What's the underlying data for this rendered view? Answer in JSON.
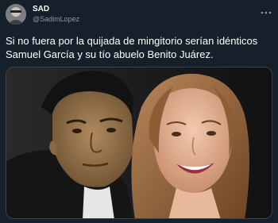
{
  "author": {
    "display_name": "SAD",
    "handle": "@SadimLopez",
    "avatar_icon": "avatar-photo-icon"
  },
  "menu": {
    "icon": "more-dots-icon"
  },
  "tweet": {
    "text": "Si no fuera por la quijada de mingitorio serían idénticos Samuel García y su tío abuelo Benito Juárez."
  },
  "media": {
    "kind": "photo",
    "icon": "photo-icon"
  },
  "colors": {
    "background": "#15202b",
    "text_primary": "#ffffff",
    "text_secondary": "#8b98a5",
    "border": "#38444d"
  }
}
